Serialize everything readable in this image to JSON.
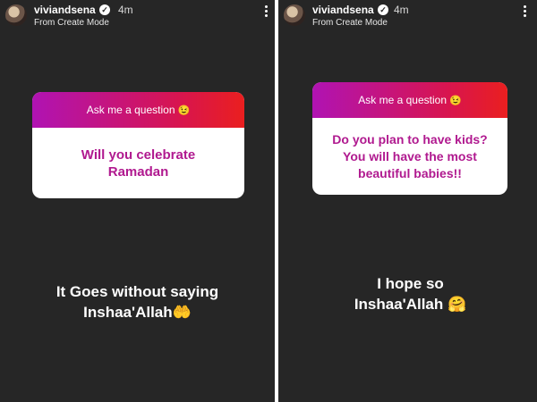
{
  "stories": [
    {
      "username": "viviandsena",
      "time": "4m",
      "subtitle": "From Create Mode",
      "prompt_title": "Ask me a question",
      "prompt_emoji": "😉",
      "question": "Will you celebrate Ramadan",
      "reply_line1": "It Goes without saying",
      "reply_line2": "Inshaa'Allah🤲"
    },
    {
      "username": "viviandsena",
      "time": "4m",
      "subtitle": "From Create Mode",
      "prompt_title": "Ask me a question",
      "prompt_emoji": "😉",
      "question": "Do you plan to have kids? You will have the most beautiful babies!!",
      "reply_line1": "I hope so",
      "reply_line2": "Inshaa'Allah 🤗"
    }
  ],
  "colors": {
    "background": "#262626",
    "gradient_start": "#b013b3",
    "gradient_end": "#ea1f1f",
    "question_text": "#b0198f"
  }
}
